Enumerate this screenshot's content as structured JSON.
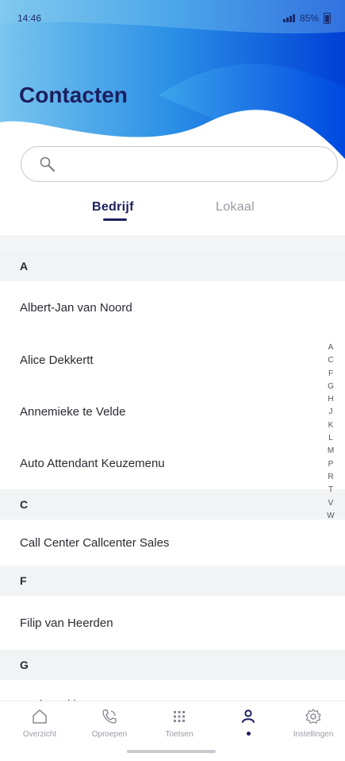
{
  "status_bar": {
    "time": "14:46",
    "battery": "85%"
  },
  "header": {
    "title": "Contacten"
  },
  "search": {
    "placeholder": ""
  },
  "tabs": [
    {
      "label": "Bedrijf",
      "active": true
    },
    {
      "label": "Lokaal",
      "active": false
    }
  ],
  "sections": [
    {
      "letter": "A",
      "contacts": [
        "Albert-Jan van Noord",
        "Alice Dekkertt",
        "Annemieke te Velde",
        "Auto Attendant Keuzemenu"
      ]
    },
    {
      "letter": "C",
      "contacts": [
        "Call Center Callcenter Sales"
      ]
    },
    {
      "letter": "F",
      "contacts": [
        "Filip van Heerden"
      ]
    },
    {
      "letter": "G",
      "contacts": [
        "Gerja Dekker"
      ]
    }
  ],
  "alphabet_index": [
    "A",
    "C",
    "F",
    "G",
    "H",
    "J",
    "K",
    "L",
    "M",
    "P",
    "R",
    "T",
    "V",
    "W"
  ],
  "bottom_nav": [
    {
      "label": "Overzicht",
      "icon": "home-icon"
    },
    {
      "label": "Oproepen",
      "icon": "phone-icon"
    },
    {
      "label": "Toetsen",
      "icon": "dialpad-icon"
    },
    {
      "label": "",
      "icon": "contacts-icon",
      "active": true
    },
    {
      "label": "Instellingen",
      "icon": "gear-icon"
    }
  ],
  "colors": {
    "brand": "#1c1f5e",
    "wave_blue": "#0a56e0",
    "section_bg": "#f1f3f5"
  }
}
